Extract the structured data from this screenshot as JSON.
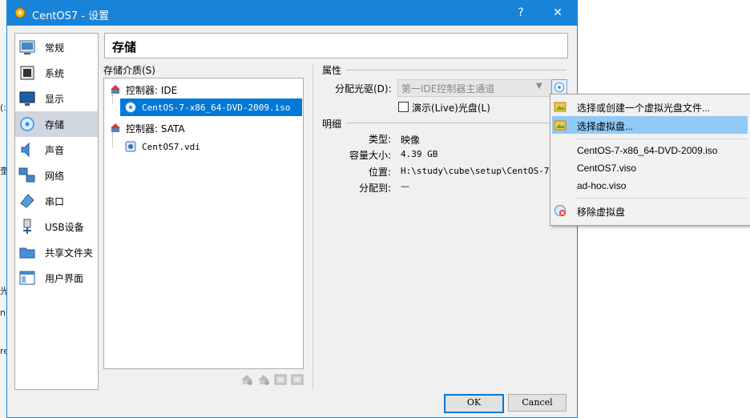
{
  "window": {
    "title": "CentOS7 - 设置",
    "help_button": "?",
    "close_button": "✕"
  },
  "categories": [
    {
      "label": "常规",
      "icon": "general-icon"
    },
    {
      "label": "系统",
      "icon": "system-icon"
    },
    {
      "label": "显示",
      "icon": "display-icon"
    },
    {
      "label": "存储",
      "icon": "storage-icon",
      "selected": true
    },
    {
      "label": "声音",
      "icon": "audio-icon"
    },
    {
      "label": "网络",
      "icon": "network-icon"
    },
    {
      "label": "串口",
      "icon": "serial-port-icon"
    },
    {
      "label": "USB设备",
      "icon": "usb-icon"
    },
    {
      "label": "共享文件夹",
      "icon": "shared-folder-icon"
    },
    {
      "label": "用户界面",
      "icon": "user-interface-icon"
    }
  ],
  "header": {
    "title": "存储"
  },
  "storage": {
    "label": "存储介质(S)",
    "tree": [
      {
        "label": "控制器: IDE",
        "type": "controller"
      },
      {
        "label": "CentOS-7-x86_64-DVD-2009.iso",
        "type": "optical",
        "selected": true
      },
      {
        "label": "控制器: SATA",
        "type": "controller"
      },
      {
        "label": "CentOS7.vdi",
        "type": "harddisk"
      }
    ],
    "toolbar_icons": [
      "add-attachment-icon",
      "remove-attachment-icon",
      "add-controller-icon",
      "remove-controller-icon"
    ]
  },
  "attributes": {
    "section_label": "属性",
    "drive_label": "分配光驱(D):",
    "drive_value": "第一IDE控制器主通道",
    "live_cd_label": "演示(Live)光盘(L)",
    "live_cd_checked": false
  },
  "details": {
    "section_label": "明细",
    "rows": [
      {
        "key": "类型:",
        "value": "映像"
      },
      {
        "key": "容量大小:",
        "value": "4.39  GB"
      },
      {
        "key": "位置:",
        "value": "H:\\study\\cube\\setup\\CentOS-7-x8"
      },
      {
        "key": "分配到:",
        "value": "—"
      }
    ]
  },
  "buttons": {
    "ok": "OK",
    "cancel": "Cancel"
  },
  "menu": {
    "items": [
      {
        "label": "选择或创建一个虚拟光盘文件...",
        "icon": "disk-folder-icon"
      },
      {
        "label": "选择虚拟盘...",
        "icon": "disk-folder-icon",
        "highlighted": true
      },
      {
        "label": "CentOS-7-x86_64-DVD-2009.iso"
      },
      {
        "label": "CentOS7.viso"
      },
      {
        "label": "ad-hoc.viso"
      },
      {
        "label": "移除虚拟盘",
        "icon": "remove-disk-icon"
      }
    ]
  },
  "background_fragments": [
    "(:",
    "奎",
    "光",
    "n",
    "re"
  ],
  "colors": {
    "titlebar": "#1883d7",
    "selection": "#0078d7",
    "menu_highlight": "#91c9f7"
  }
}
